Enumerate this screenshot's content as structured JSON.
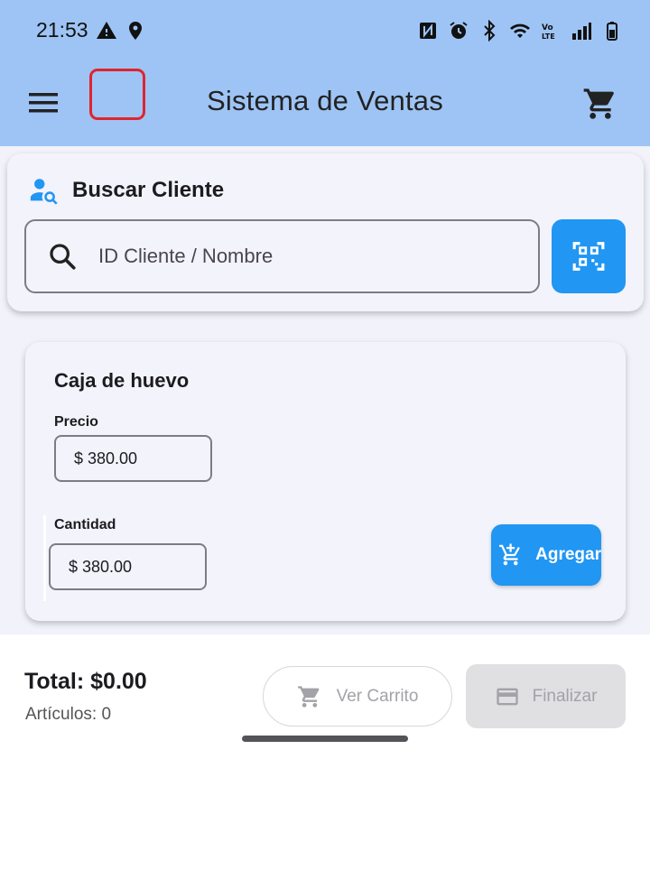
{
  "status_bar": {
    "time": "21:53",
    "left_icons": [
      "warning-icon",
      "location-icon"
    ],
    "right_icons": [
      "nfc-icon",
      "alarm-icon",
      "bluetooth-icon",
      "wifi-icon",
      "volte-icon",
      "signal-icon",
      "battery-icon"
    ]
  },
  "app_bar": {
    "title": "Sistema de Ventas",
    "background": "#9ec4f5"
  },
  "search": {
    "title": "Buscar Cliente",
    "placeholder": "ID Cliente / Nombre",
    "value": ""
  },
  "product": {
    "name": "Caja de huevo",
    "price_label": "Precio",
    "price_value": "$ 380.00",
    "quantity_label": "Cantidad",
    "quantity_value": "$ 380.00",
    "add_label": "Agregar"
  },
  "summary": {
    "total": "Total: $0.00",
    "items": "Artículos: 0",
    "view_cart_label": "Ver Carrito",
    "finish_label": "Finalizar"
  },
  "colors": {
    "accent": "#2196f3",
    "logo_outline": "#e0242f",
    "disabled": "#a2a2a8"
  }
}
